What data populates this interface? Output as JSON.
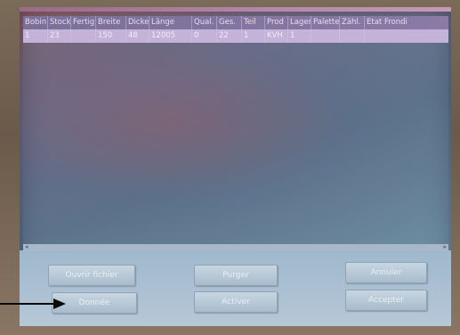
{
  "table": {
    "columns": [
      "Bobin",
      "Stock",
      "Fertig",
      "Breite",
      "Dicke",
      "Länge",
      "Qual.",
      "Ges.",
      "Teil",
      "Prod",
      "Lager",
      "Palette",
      "Zähl.",
      "Etat Frondi"
    ],
    "rows": [
      [
        "1",
        "23",
        "",
        "150",
        "48",
        "12005",
        "0",
        "22",
        "1",
        "KVH",
        "1",
        "",
        "",
        ""
      ]
    ]
  },
  "buttons": {
    "open_file": "Ouvrir fichier",
    "purge": "Purger",
    "cancel": "Annuler",
    "data": "Donnée",
    "activate": "Activer",
    "accept": "Accepter"
  },
  "icons": {
    "scroll_left": "scroll-left-arrow",
    "scroll_right": "scroll-right-arrow",
    "pointer": "annotation-arrow"
  }
}
